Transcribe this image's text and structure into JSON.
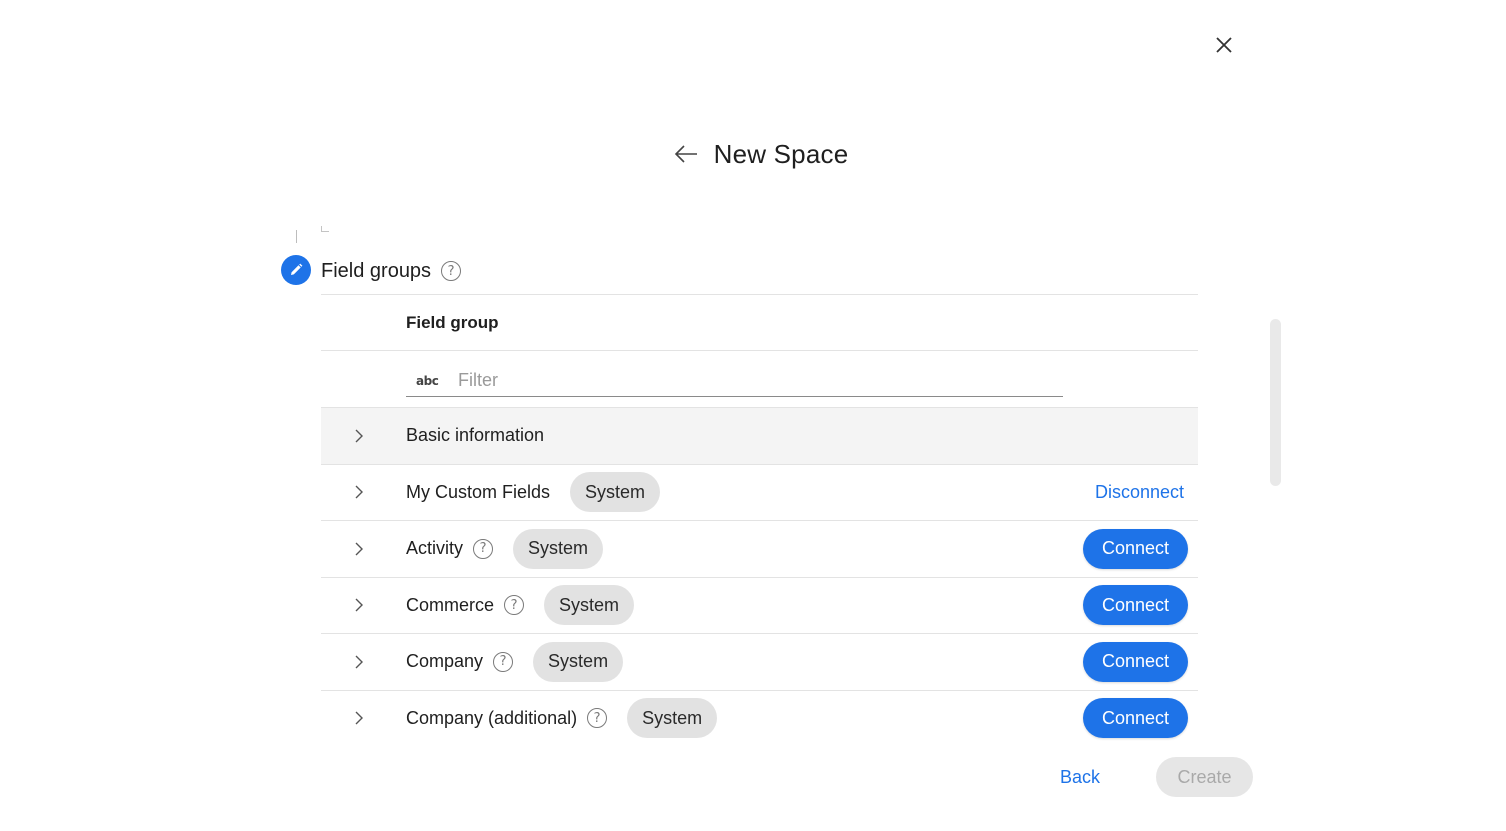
{
  "header": {
    "title": "New Space"
  },
  "section": {
    "title": "Field groups"
  },
  "table": {
    "column_header": "Field group",
    "filter": {
      "placeholder": "Filter",
      "icon_text": "abc"
    },
    "rows": [
      {
        "label": "Basic information",
        "badge": "",
        "action": "",
        "help": false
      },
      {
        "label": "My Custom Fields",
        "badge": "System",
        "action": "Disconnect",
        "help": false
      },
      {
        "label": "Activity",
        "badge": "System",
        "action": "Connect",
        "help": true
      },
      {
        "label": "Commerce",
        "badge": "System",
        "action": "Connect",
        "help": true
      },
      {
        "label": "Company",
        "badge": "System",
        "action": "Connect",
        "help": true
      },
      {
        "label": "Company (additional)",
        "badge": "System",
        "action": "Connect",
        "help": true
      }
    ]
  },
  "footer": {
    "back_label": "Back",
    "create_label": "Create"
  },
  "colors": {
    "accent": "#1e73e8",
    "badge_bg": "#e2e2e2",
    "disabled_bg": "#e6e6e6"
  }
}
